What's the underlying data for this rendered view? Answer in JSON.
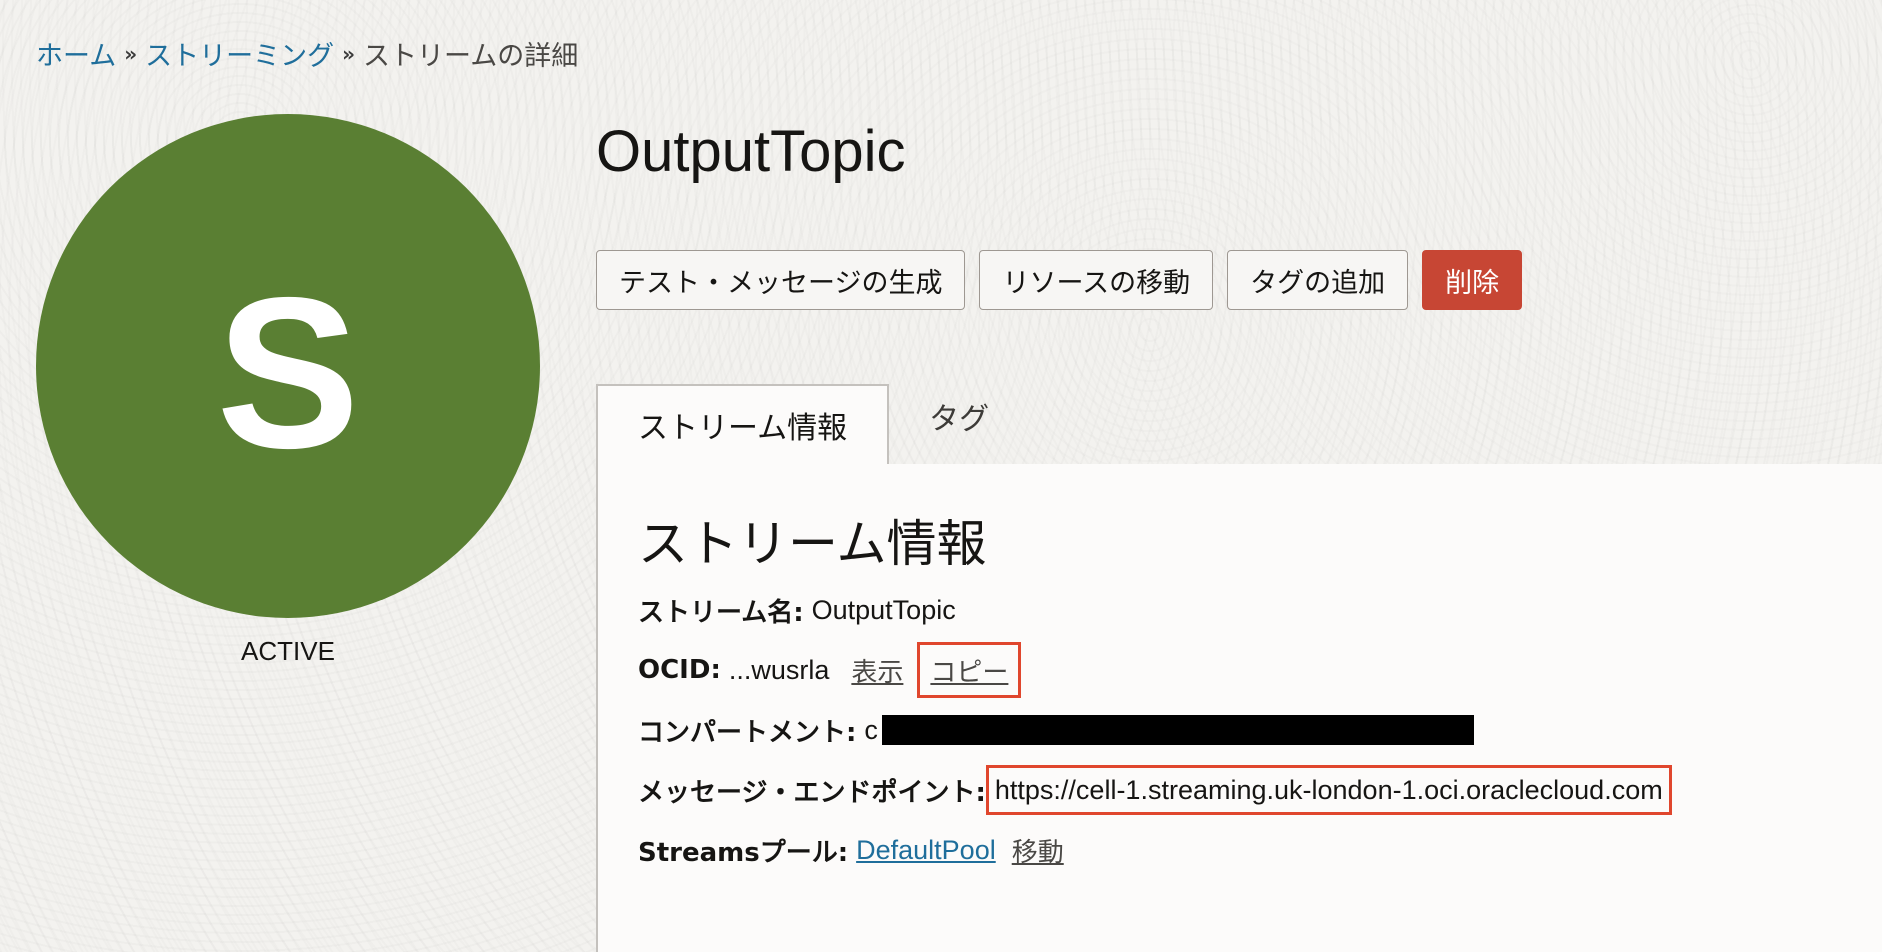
{
  "breadcrumb": {
    "home": "ホーム",
    "streaming": "ストリーミング",
    "current": "ストリームの詳細",
    "separator": "»"
  },
  "avatar": {
    "letter": "S",
    "color": "#5a7f33",
    "status": "ACTIVE"
  },
  "title": "OutputTopic",
  "actions": {
    "generate_test_message": "テスト・メッセージの生成",
    "move_resource": "リソースの移動",
    "add_tags": "タグの追加",
    "delete": "削除"
  },
  "tabs": [
    {
      "label": "ストリーム情報",
      "active": true
    },
    {
      "label": "タグ",
      "active": false
    }
  ],
  "stream_info": {
    "heading": "ストリーム情報",
    "name_label": "ストリーム名:",
    "name_value": "OutputTopic",
    "ocid_label": "OCID:",
    "ocid_value": "...wusrla",
    "ocid_show": "表示",
    "ocid_copy": "コピー",
    "compartment_label": "コンパートメント:",
    "compartment_value_prefix": "c",
    "endpoint_label": "メッセージ・エンドポイント:",
    "endpoint_value": "https://cell-1.streaming.uk-london-1.oci.oraclecloud.com",
    "pool_label": "Streamsプール:",
    "pool_value": "DefaultPool",
    "pool_move": "移動"
  },
  "colors": {
    "link": "#1f6e9b",
    "danger": "#c74634",
    "highlight": "#e0462d"
  }
}
